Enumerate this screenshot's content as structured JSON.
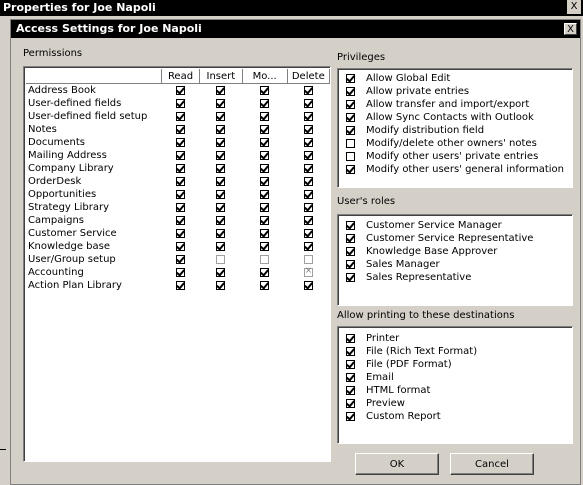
{
  "outer_window": {
    "title": "Properties for Joe Napoli",
    "close": "X"
  },
  "dialog": {
    "title": "Access Settings for Joe Napoli",
    "close": "X"
  },
  "permissions": {
    "label": "Permissions",
    "columns": [
      "Read",
      "Insert",
      "Mo...",
      "Delete"
    ],
    "rows": [
      {
        "name": "Address Book",
        "values": [
          "checked",
          "checked",
          "checked",
          "checked"
        ]
      },
      {
        "name": "User-defined fields",
        "values": [
          "checked",
          "checked",
          "checked",
          "checked"
        ]
      },
      {
        "name": "User-defined field setup",
        "values": [
          "checked",
          "checked",
          "checked",
          "checked"
        ]
      },
      {
        "name": "Notes",
        "values": [
          "checked",
          "checked",
          "checked",
          "checked"
        ]
      },
      {
        "name": "Documents",
        "values": [
          "checked",
          "checked",
          "checked",
          "checked"
        ]
      },
      {
        "name": "Mailing Address",
        "values": [
          "checked",
          "checked",
          "checked",
          "checked"
        ]
      },
      {
        "name": "Company Library",
        "values": [
          "checked",
          "checked",
          "checked",
          "checked"
        ]
      },
      {
        "name": "OrderDesk",
        "values": [
          "checked",
          "checked",
          "checked",
          "checked"
        ]
      },
      {
        "name": "Opportunities",
        "values": [
          "checked",
          "checked",
          "checked",
          "checked"
        ]
      },
      {
        "name": "Strategy Library",
        "values": [
          "checked",
          "checked",
          "checked",
          "checked"
        ]
      },
      {
        "name": "Campaigns",
        "values": [
          "checked",
          "checked",
          "checked",
          "checked"
        ]
      },
      {
        "name": "Customer Service",
        "values": [
          "checked",
          "checked",
          "checked",
          "checked"
        ]
      },
      {
        "name": "Knowledge base",
        "values": [
          "checked",
          "checked",
          "checked",
          "checked"
        ]
      },
      {
        "name": "User/Group setup",
        "values": [
          "checked",
          "unchecked-dim",
          "unchecked-dim",
          "unchecked-dim"
        ]
      },
      {
        "name": "Accounting",
        "values": [
          "checked",
          "checked",
          "checked",
          "disabled-x"
        ]
      },
      {
        "name": "Action Plan Library",
        "values": [
          "checked",
          "checked",
          "checked",
          "checked"
        ]
      }
    ]
  },
  "privileges": {
    "label": "Privileges",
    "items": [
      {
        "label": "Allow Global Edit",
        "checked": true
      },
      {
        "label": "Allow private entries",
        "checked": true
      },
      {
        "label": "Allow transfer and import/export",
        "checked": true
      },
      {
        "label": "Allow Sync Contacts with Outlook",
        "checked": true
      },
      {
        "label": "Modify distribution field",
        "checked": true
      },
      {
        "label": "Modify/delete other owners' notes",
        "checked": false
      },
      {
        "label": "Modify other users' private entries",
        "checked": false
      },
      {
        "label": "Modify other users' general information",
        "checked": true
      }
    ]
  },
  "roles": {
    "label": "User's roles",
    "items": [
      {
        "label": "Customer Service Manager",
        "checked": true
      },
      {
        "label": "Customer Service Representative",
        "checked": true
      },
      {
        "label": "Knowledge Base Approver",
        "checked": true
      },
      {
        "label": "Sales Manager",
        "checked": true
      },
      {
        "label": "Sales Representative",
        "checked": true
      }
    ]
  },
  "printing": {
    "label": "Allow printing to these destinations",
    "items": [
      {
        "label": "Printer",
        "checked": true
      },
      {
        "label": "File (Rich Text Format)",
        "checked": true
      },
      {
        "label": "File (PDF Format)",
        "checked": true
      },
      {
        "label": "Email",
        "checked": true
      },
      {
        "label": "HTML format",
        "checked": true
      },
      {
        "label": "Preview",
        "checked": true
      },
      {
        "label": "Custom Report",
        "checked": true
      }
    ]
  },
  "buttons": {
    "ok": "OK",
    "cancel": "Cancel"
  }
}
